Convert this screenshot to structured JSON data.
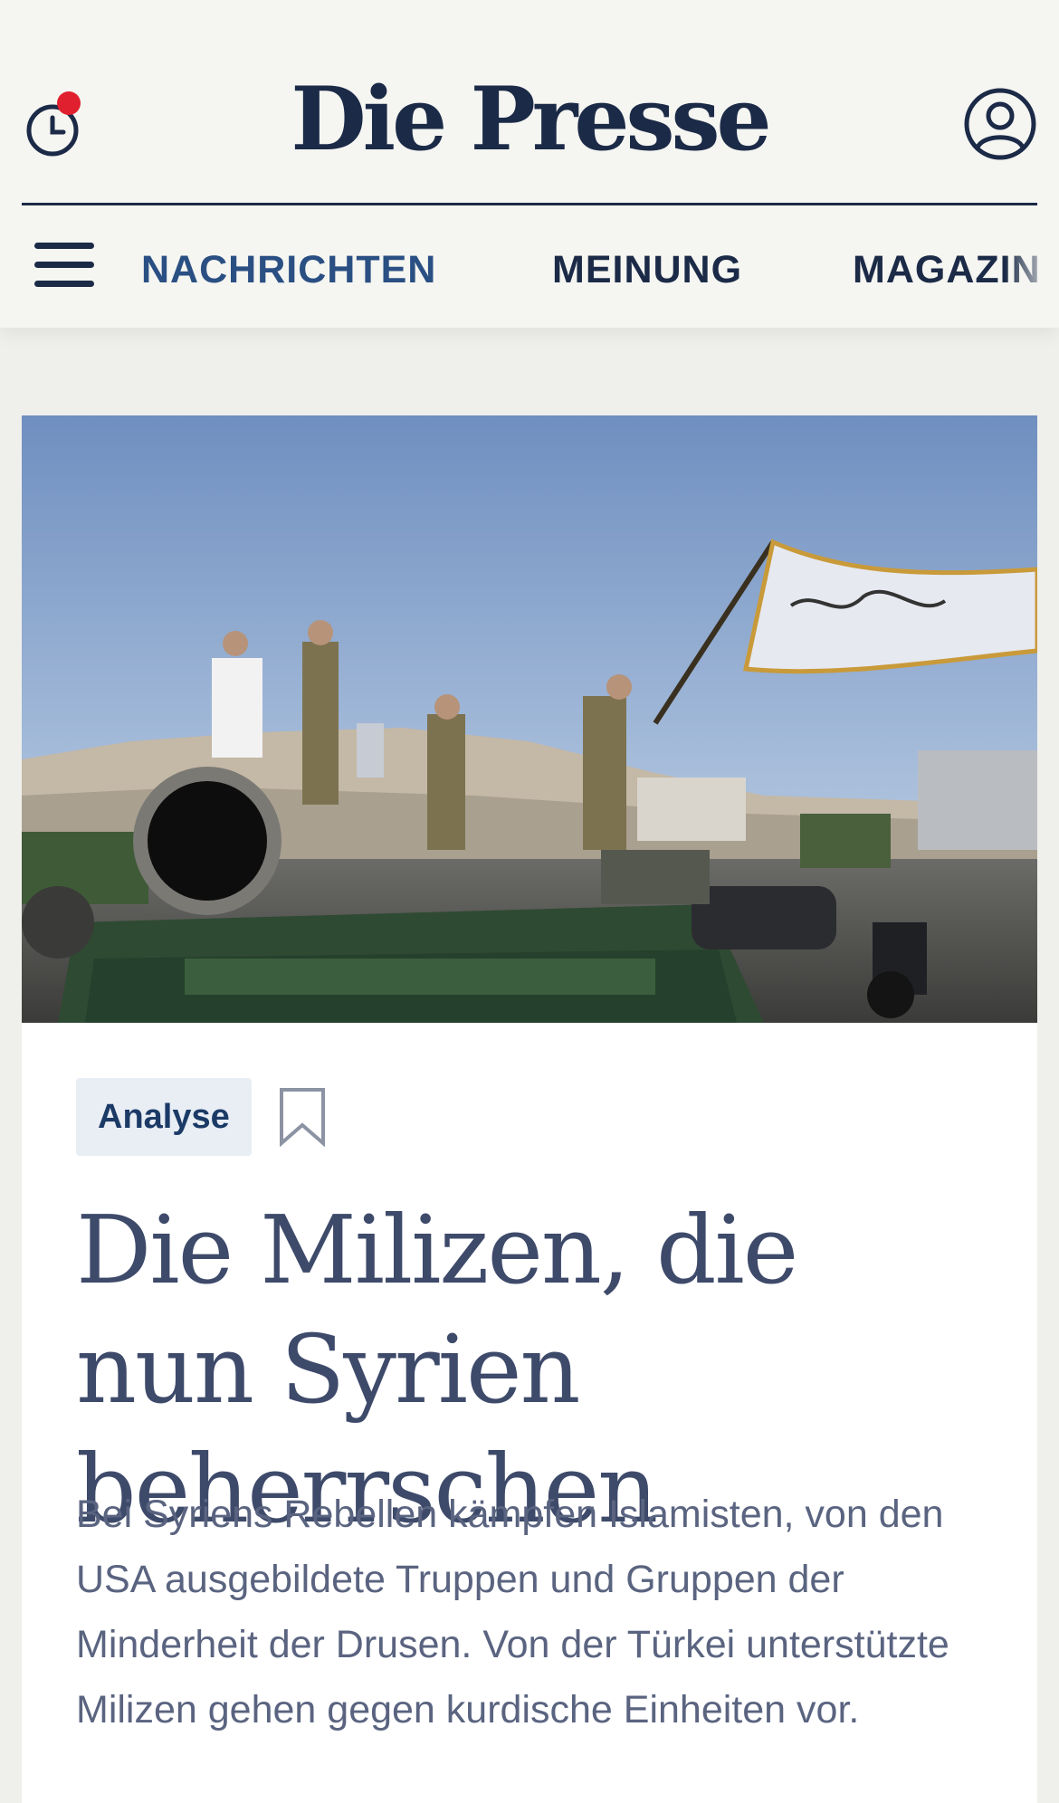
{
  "header": {
    "logo": "Die Presse",
    "history_icon": "clock-with-notification-dot-icon",
    "account_icon": "user-circle-icon"
  },
  "nav": {
    "menu_icon": "hamburger-menu-icon",
    "items": [
      {
        "label": "NACHRICHTEN",
        "active": true
      },
      {
        "label": "MEINUNG",
        "active": false
      },
      {
        "label": "MAGAZIN",
        "active": false
      }
    ]
  },
  "article": {
    "badge": "Analyse",
    "bookmark_icon": "bookmark-icon",
    "headline": "Die Milizen, die nun Syrien beherrschen",
    "teaser": "Bei Syriens Rebellen kämpfen Islamisten, von den USA ausgebildete Truppen und Gruppen der Minderheit der Drusen. Von der Türkei unterstützte Milizen gehen gegen kurdische Einheiten vor."
  },
  "colors": {
    "brand_navy": "#1b2a47",
    "active_nav": "#2a4f83",
    "notification_dot": "#e0202e",
    "badge_bg": "#e9eef5"
  }
}
